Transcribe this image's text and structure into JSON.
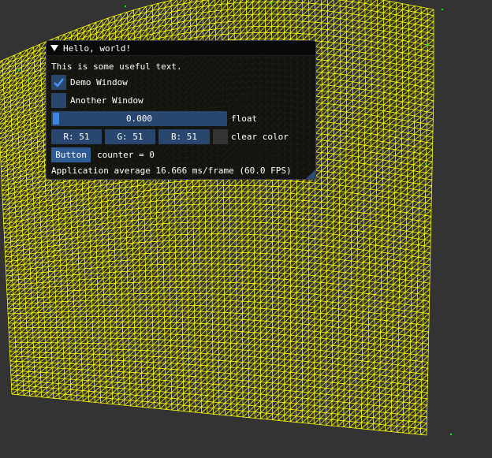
{
  "window": {
    "title": "Hello, world!",
    "text": "This is some useful text.",
    "demo_window_label": "Demo Window",
    "demo_window_checked": true,
    "another_window_label": "Another Window",
    "another_window_checked": false,
    "slider_value": "0.000",
    "slider_fraction": 0.0,
    "slider_label": "float",
    "color_r": "R: 51",
    "color_g": "G: 51",
    "color_b": "B: 51",
    "color_label": "clear color",
    "swatch_color": "#333333",
    "button_label": "Button",
    "counter_text": "counter = 0",
    "stats_text": "Application average 16.666 ms/frame (60.0 FPS)"
  },
  "scene": {
    "background_color": "#333333",
    "mesh_color": "#ffff00",
    "point_color": "#00ff00"
  }
}
